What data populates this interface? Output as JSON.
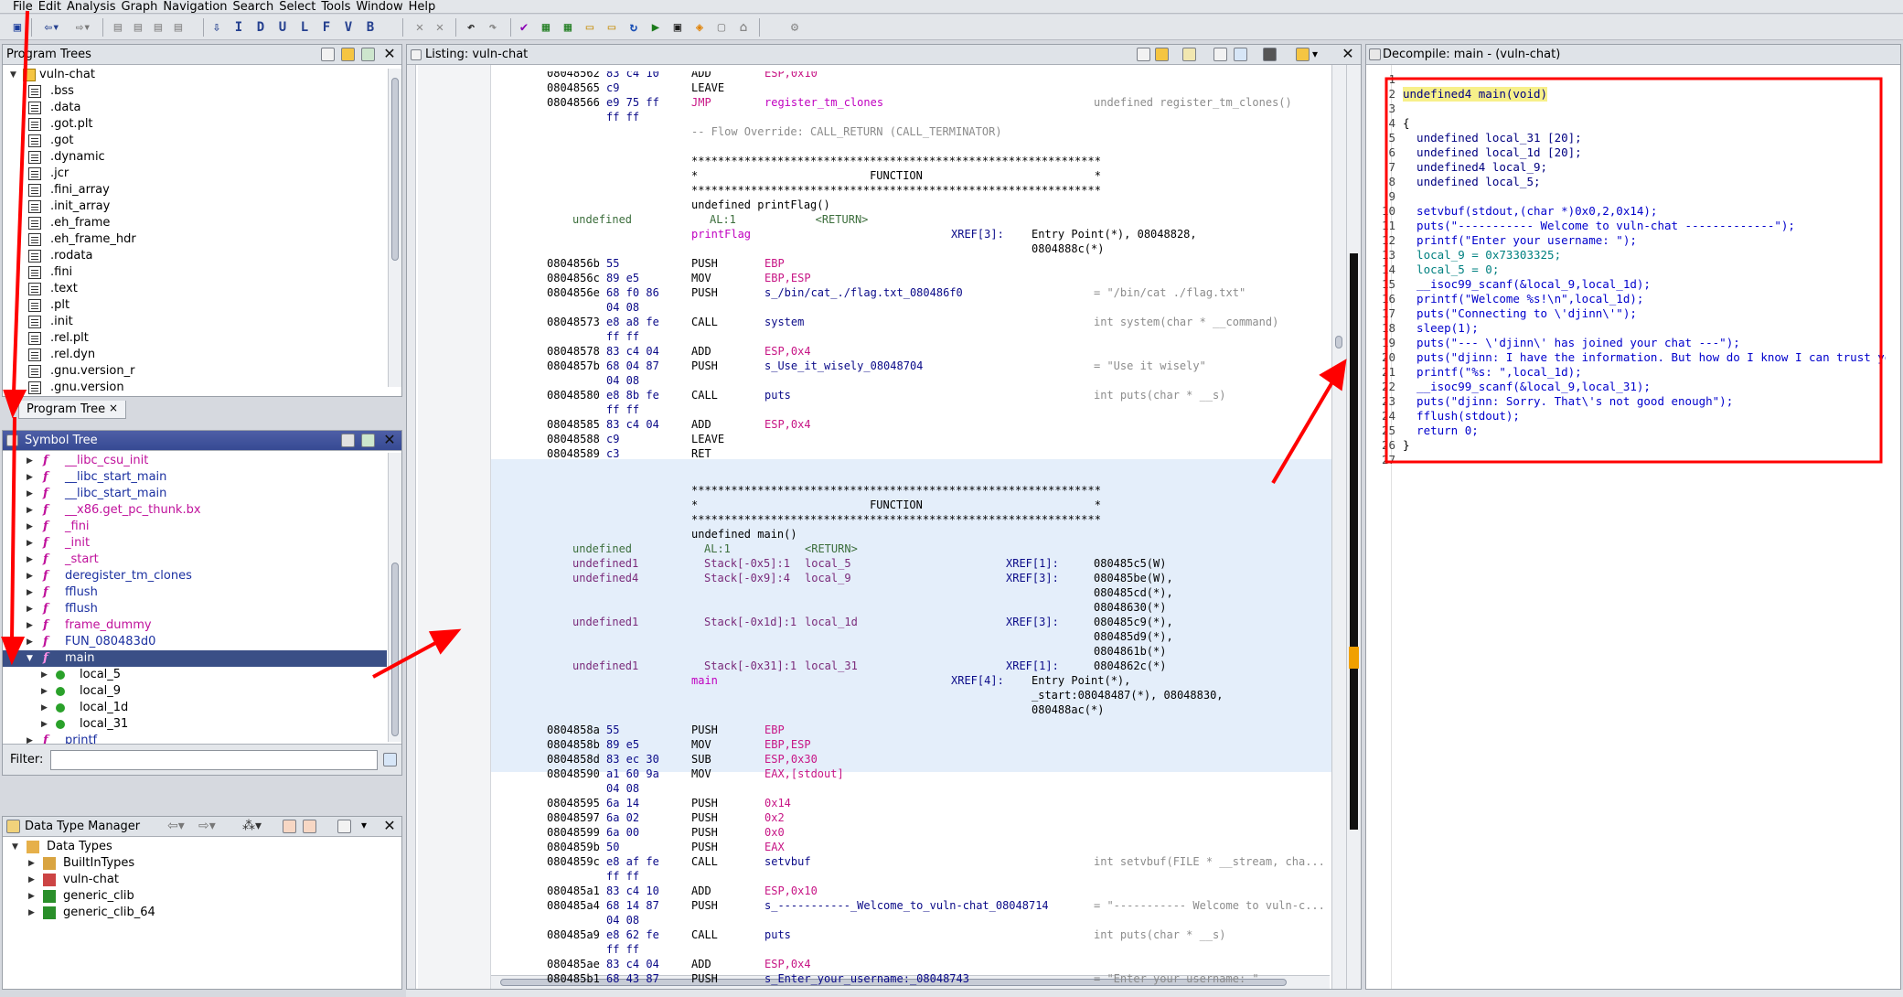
{
  "menu": [
    "File",
    "Edit",
    "Analysis",
    "Graph",
    "Navigation",
    "Search",
    "Select",
    "Tools",
    "Window",
    "Help"
  ],
  "toolbar_letters": [
    "I",
    "D",
    "U",
    "L",
    "F",
    "V",
    "B"
  ],
  "program_trees": {
    "title": "Program Trees",
    "root": "vuln-chat",
    "items": [
      ".bss",
      ".data",
      ".got.plt",
      ".got",
      ".dynamic",
      ".jcr",
      ".fini_array",
      ".init_array",
      ".eh_frame",
      ".eh_frame_hdr",
      ".rodata",
      ".fini",
      ".text",
      ".plt",
      ".init",
      ".rel.plt",
      ".rel.dyn",
      ".gnu.version_r",
      ".gnu.version"
    ],
    "tab": "Program Tree"
  },
  "symbol_tree": {
    "title": "Symbol Tree",
    "items": [
      {
        "name": "__libc_csu_init",
        "style": "pink"
      },
      {
        "name": "__libc_start_main",
        "style": "blue"
      },
      {
        "name": "__libc_start_main",
        "style": "blue"
      },
      {
        "name": "__x86.get_pc_thunk.bx",
        "style": "pink"
      },
      {
        "name": "_fini",
        "style": "pink"
      },
      {
        "name": "_init",
        "style": "pink"
      },
      {
        "name": "_start",
        "style": "pink"
      },
      {
        "name": "deregister_tm_clones",
        "style": "blue"
      },
      {
        "name": "fflush",
        "style": "blue"
      },
      {
        "name": "fflush",
        "style": "blue"
      },
      {
        "name": "frame_dummy",
        "style": "pink"
      },
      {
        "name": "FUN_080483d0",
        "style": "blue"
      },
      {
        "name": "main",
        "style": "selected"
      }
    ],
    "children": [
      "local_5",
      "local_9",
      "local_1d",
      "local_31"
    ],
    "after": "printf",
    "filter_label": "Filter:"
  },
  "data_type_manager": {
    "title": "Data Type Manager",
    "root": "Data Types",
    "items": [
      "BuiltInTypes",
      "vuln-chat",
      "generic_clib",
      "generic_clib_64"
    ]
  },
  "listing": {
    "title": "Listing:  vuln-chat",
    "lines": [
      {
        "a": "08048562",
        "b": "83 c4 10",
        "m": "ADD",
        "o": "ESP,0x10",
        "c": ""
      },
      {
        "a": "08048565",
        "b": "c9",
        "m": "LEAVE",
        "o": "",
        "c": ""
      },
      {
        "a": "08048566",
        "b": "e9 75 ff",
        "m": "JMP",
        "o": "register_tm_clones",
        "c": "undefined register_tm_clones()"
      },
      {
        "a": "",
        "b": "ff ff",
        "m": "",
        "o": "",
        "c": ""
      },
      {
        "a": "",
        "b": "",
        "m": "",
        "o": "",
        "c": "",
        "raw": "-- Flow Override: CALL_RETURN (CALL_TERMINATOR)"
      },
      {
        "a": "",
        "b": "",
        "m": "",
        "o": "",
        "c": "",
        "raw": ""
      },
      {
        "raw": "**************************************************************"
      },
      {
        "raw": "*                          FUNCTION                          *"
      },
      {
        "raw": "**************************************************************"
      },
      {
        "raw": "undefined printFlag()"
      },
      {
        "raw": "AL:1            <RETURN>",
        "pre": "undefined"
      },
      {
        "raw": "printFlag",
        "xref": "XREF[3]:",
        "xv": "Entry Point(*), 08048828,"
      },
      {
        "raw": "",
        "xv": "0804888c(*)"
      },
      {
        "a": "0804856b",
        "b": "55",
        "m": "PUSH",
        "o": "EBP",
        "c": ""
      },
      {
        "a": "0804856c",
        "b": "89 e5",
        "m": "MOV",
        "o": "EBP,ESP",
        "c": ""
      },
      {
        "a": "0804856e",
        "b": "68 f0 86",
        "m": "PUSH",
        "o": "s_/bin/cat_./flag.txt_080486f0",
        "c": "= \"/bin/cat ./flag.txt\""
      },
      {
        "a": "",
        "b": "04 08",
        "m": "",
        "o": "",
        "c": ""
      },
      {
        "a": "08048573",
        "b": "e8 a8 fe",
        "m": "CALL",
        "o": "system",
        "c": "int system(char * __command)"
      },
      {
        "a": "",
        "b": "ff ff",
        "m": "",
        "o": "",
        "c": ""
      },
      {
        "a": "08048578",
        "b": "83 c4 04",
        "m": "ADD",
        "o": "ESP,0x4",
        "c": ""
      },
      {
        "a": "0804857b",
        "b": "68 04 87",
        "m": "PUSH",
        "o": "s_Use_it_wisely_08048704",
        "c": "= \"Use it wisely\""
      },
      {
        "a": "",
        "b": "04 08",
        "m": "",
        "o": "",
        "c": ""
      },
      {
        "a": "08048580",
        "b": "e8 8b fe",
        "m": "CALL",
        "o": "puts",
        "c": "int puts(char * __s)"
      },
      {
        "a": "",
        "b": "ff ff",
        "m": "",
        "o": "",
        "c": ""
      },
      {
        "a": "08048585",
        "b": "83 c4 04",
        "m": "ADD",
        "o": "ESP,0x4",
        "c": ""
      },
      {
        "a": "08048588",
        "b": "c9",
        "m": "LEAVE",
        "o": "",
        "c": ""
      },
      {
        "a": "08048589",
        "b": "c3",
        "m": "RET",
        "o": "",
        "c": ""
      }
    ],
    "main_block": [
      "**************************************************************",
      "*                          FUNCTION                          *",
      "**************************************************************"
    ],
    "main_sig": "undefined main()",
    "main_vars": [
      {
        "t": "undefined",
        "s": "AL:1",
        "n": "<RETURN>",
        "x": "",
        "v": ""
      },
      {
        "t": "undefined1",
        "s": "Stack[-0x5]:1",
        "n": "local_5",
        "x": "XREF[1]:",
        "v": "080485c5(W)"
      },
      {
        "t": "undefined4",
        "s": "Stack[-0x9]:4",
        "n": "local_9",
        "x": "XREF[3]:",
        "v": "080485be(W),"
      },
      {
        "t": "",
        "s": "",
        "n": "",
        "x": "",
        "v": "080485cd(*),"
      },
      {
        "t": "",
        "s": "",
        "n": "",
        "x": "",
        "v": "08048630(*)"
      },
      {
        "t": "undefined1",
        "s": "Stack[-0x1d]:1",
        "n": "local_1d",
        "x": "XREF[3]:",
        "v": "080485c9(*),"
      },
      {
        "t": "",
        "s": "",
        "n": "",
        "x": "",
        "v": "080485d9(*),"
      },
      {
        "t": "",
        "s": "",
        "n": "",
        "x": "",
        "v": "0804861b(*)"
      },
      {
        "t": "undefined1",
        "s": "Stack[-0x31]:1",
        "n": "local_31",
        "x": "XREF[1]:",
        "v": "0804862c(*)"
      }
    ],
    "main_label": "main",
    "main_xref": "XREF[4]:",
    "main_xref_vals": [
      "Entry Point(*),",
      "_start:08048487(*), 08048830,",
      "080488ac(*)"
    ],
    "main_lines": [
      {
        "a": "0804858a",
        "b": "55",
        "m": "PUSH",
        "o": "EBP",
        "c": ""
      },
      {
        "a": "0804858b",
        "b": "89 e5",
        "m": "MOV",
        "o": "EBP,ESP",
        "c": ""
      },
      {
        "a": "0804858d",
        "b": "83 ec 30",
        "m": "SUB",
        "o": "ESP,0x30",
        "c": ""
      },
      {
        "a": "08048590",
        "b": "a1 60 9a",
        "m": "MOV",
        "o": "EAX,[stdout]",
        "c": ""
      },
      {
        "a": "",
        "b": "04 08",
        "m": "",
        "o": "",
        "c": ""
      },
      {
        "a": "08048595",
        "b": "6a 14",
        "m": "PUSH",
        "o": "0x14",
        "c": ""
      },
      {
        "a": "08048597",
        "b": "6a 02",
        "m": "PUSH",
        "o": "0x2",
        "c": ""
      },
      {
        "a": "08048599",
        "b": "6a 00",
        "m": "PUSH",
        "o": "0x0",
        "c": ""
      },
      {
        "a": "0804859b",
        "b": "50",
        "m": "PUSH",
        "o": "EAX",
        "c": ""
      },
      {
        "a": "0804859c",
        "b": "e8 af fe",
        "m": "CALL",
        "o": "setvbuf",
        "c": "int setvbuf(FILE * __stream, cha..."
      },
      {
        "a": "",
        "b": "ff ff",
        "m": "",
        "o": "",
        "c": ""
      },
      {
        "a": "080485a1",
        "b": "83 c4 10",
        "m": "ADD",
        "o": "ESP,0x10",
        "c": ""
      },
      {
        "a": "080485a4",
        "b": "68 14 87",
        "m": "PUSH",
        "o": "s_-----------_Welcome_to_vuln-chat_08048714",
        "c": "= \"----------- Welcome to vuln-c..."
      },
      {
        "a": "",
        "b": "04 08",
        "m": "",
        "o": "",
        "c": ""
      },
      {
        "a": "080485a9",
        "b": "e8 62 fe",
        "m": "CALL",
        "o": "puts",
        "c": "int puts(char * __s)"
      },
      {
        "a": "",
        "b": "ff ff",
        "m": "",
        "o": "",
        "c": ""
      },
      {
        "a": "080485ae",
        "b": "83 c4 04",
        "m": "ADD",
        "o": "ESP,0x4",
        "c": ""
      },
      {
        "a": "080485b1",
        "b": "68 43 87",
        "m": "PUSH",
        "o": "s_Enter_your_username:_08048743",
        "c": "= \"Enter your username: \""
      }
    ]
  },
  "decompile": {
    "title": "Decompile: main -  (vuln-chat)",
    "lines": [
      "",
      "undefined4 main(void)",
      "",
      "{",
      "  undefined local_31 [20];",
      "  undefined local_1d [20];",
      "  undefined4 local_9;",
      "  undefined local_5;",
      "  ",
      "  setvbuf(stdout,(char *)0x0,2,0x14);",
      "  puts(\"----------- Welcome to vuln-chat -------------\");",
      "  printf(\"Enter your username: \");",
      "  local_9 = 0x73303325;",
      "  local_5 = 0;",
      "  __isoc99_scanf(&local_9,local_1d);",
      "  printf(\"Welcome %s!\\n\",local_1d);",
      "  puts(\"Connecting to \\'djinn\\'\");",
      "  sleep(1);",
      "  puts(\"--- \\'djinn\\' has joined your chat ---\");",
      "  puts(\"djinn: I have the information. But how do I know I can trust you?\");",
      "  printf(\"%s: \",local_1d);",
      "  __isoc99_scanf(&local_9,local_31);",
      "  puts(\"djinn: Sorry. That\\'s not good enough\");",
      "  fflush(stdout);",
      "  return 0;",
      "}",
      ""
    ]
  },
  "colors": {
    "annotation_red": "#ff0000",
    "selected_row": "#3a4f86",
    "main_highlight": "#e4eefa"
  }
}
